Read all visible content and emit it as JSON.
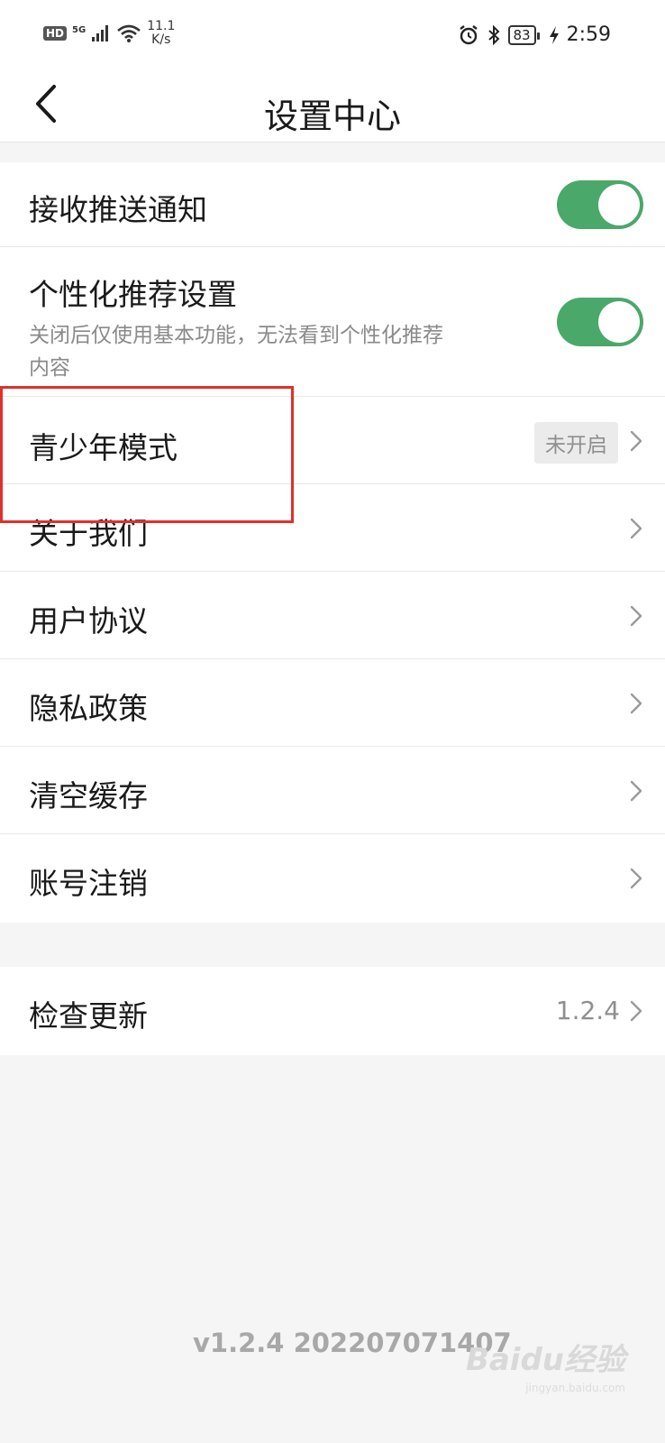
{
  "status_bar": {
    "hd": "HD",
    "network": "5G",
    "speed_value": "11.1",
    "speed_unit": "K/s",
    "battery": "83",
    "time": "2:59"
  },
  "header": {
    "title": "设置中心"
  },
  "settings": {
    "push_label": "接收推送通知",
    "push_enabled": true,
    "personal_label": "个性化推荐设置",
    "personal_desc": "关闭后仅使用基本功能，无法看到个性化推荐内容",
    "personal_enabled": true,
    "youth_label": "青少年模式",
    "youth_status": "未开启",
    "about_label": "关于我们",
    "agreement_label": "用户协议",
    "privacy_label": "隐私政策",
    "cache_label": "清空缓存",
    "cancel_label": "账号注销",
    "update_label": "检查更新",
    "update_version": "1.2.4"
  },
  "footer": {
    "version": "v1.2.4 202207071407",
    "watermark": "Baidu经验",
    "watermark_sub": "jingyan.baidu.com"
  },
  "colors": {
    "toggle_on": "#4aa86a",
    "highlight": "#e0302a"
  }
}
